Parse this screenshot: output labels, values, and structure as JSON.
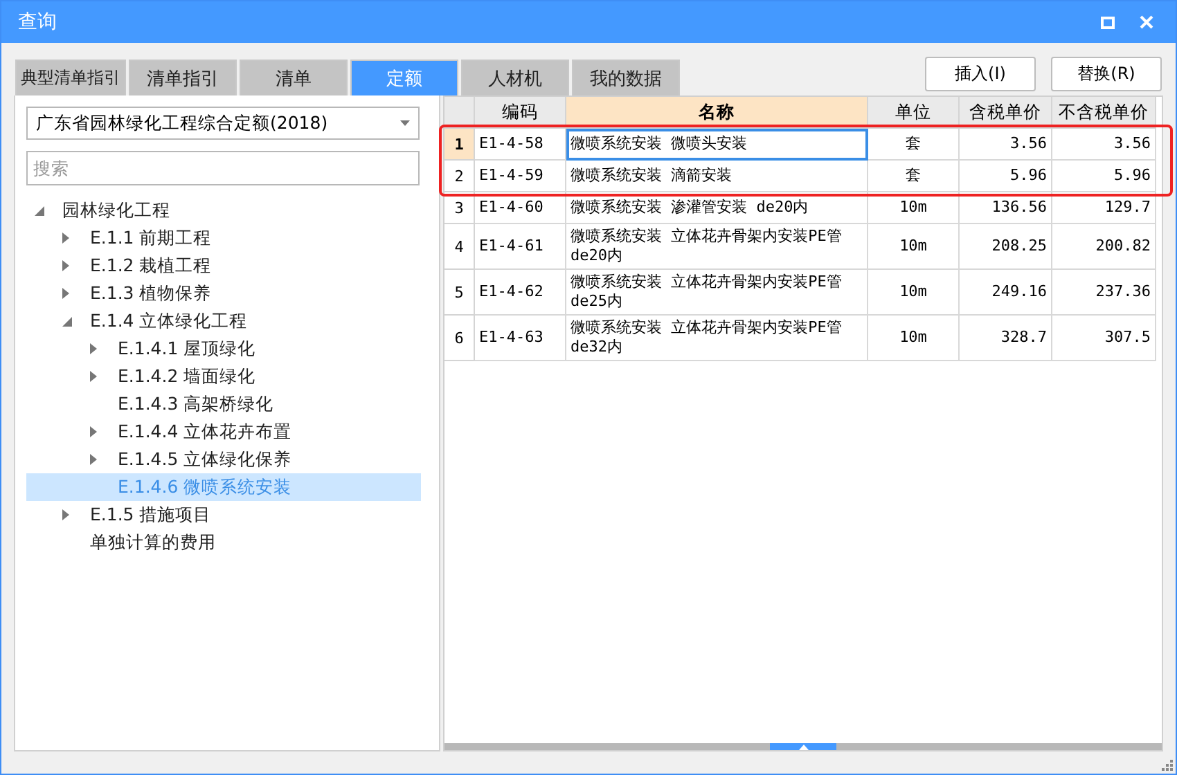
{
  "window": {
    "title": "查询"
  },
  "tabs": [
    {
      "label": "典型清单指引",
      "selected": false
    },
    {
      "label": "清单指引",
      "selected": false
    },
    {
      "label": "清单",
      "selected": false
    },
    {
      "label": "定额",
      "selected": true
    },
    {
      "label": "人材机",
      "selected": false
    },
    {
      "label": "我的数据",
      "selected": false
    }
  ],
  "buttons": [
    "插入(I)",
    "替换(R)"
  ],
  "library_select": {
    "value": "广东省园林绿化工程综合定额(2018)"
  },
  "search": {
    "placeholder": "搜索"
  },
  "tree": [
    {
      "label": "园林绿化工程",
      "expanded": true,
      "selected": false,
      "children": [
        {
          "label": "E.1.1 前期工程",
          "expanded": false,
          "selected": false
        },
        {
          "label": "E.1.2 栽植工程",
          "expanded": false,
          "selected": false
        },
        {
          "label": "E.1.3 植物保养",
          "expanded": false,
          "selected": false
        },
        {
          "label": "E.1.4 立体绿化工程",
          "expanded": true,
          "selected": false,
          "children": [
            {
              "label": "E.1.4.1 屋顶绿化",
              "expanded": false,
              "selected": false
            },
            {
              "label": "E.1.4.2 墙面绿化",
              "expanded": false,
              "selected": false
            },
            {
              "label": "E.1.4.3 高架桥绿化",
              "selected": false
            },
            {
              "label": "E.1.4.4 立体花卉布置",
              "expanded": false,
              "selected": false
            },
            {
              "label": "E.1.4.5 立体绿化保养",
              "expanded": false,
              "selected": false
            },
            {
              "label": "E.1.4.6 微喷系统安装",
              "selected": true
            }
          ]
        },
        {
          "label": "E.1.5 措施项目",
          "expanded": false,
          "selected": false
        },
        {
          "label": "单独计算的费用",
          "selected": false
        }
      ]
    }
  ],
  "table": {
    "columns": [
      "编码",
      "名称",
      "单位",
      "含税单价",
      "不含税单价"
    ],
    "rows": [
      {
        "index": "1",
        "selected": true,
        "highlighted": true,
        "cells": [
          "E1-4-58",
          "微喷系统安装 微喷头安装",
          "套",
          "3.56",
          "3.56"
        ]
      },
      {
        "index": "2",
        "selected": false,
        "highlighted": true,
        "cells": [
          "E1-4-59",
          "微喷系统安装 滴箭安装",
          "套",
          "5.96",
          "5.96"
        ]
      },
      {
        "index": "3",
        "selected": false,
        "highlighted": false,
        "cells": [
          "E1-4-60",
          "微喷系统安装 渗灌管安装 de20内",
          "10m",
          "136.56",
          "129.7"
        ]
      },
      {
        "index": "4",
        "selected": false,
        "highlighted": false,
        "cells": [
          "E1-4-61",
          "微喷系统安装 立体花卉骨架内安装PE管de20内",
          "10m",
          "208.25",
          "200.82"
        ]
      },
      {
        "index": "5",
        "selected": false,
        "highlighted": false,
        "cells": [
          "E1-4-62",
          "微喷系统安装 立体花卉骨架内安装PE管de25内",
          "10m",
          "249.16",
          "237.36"
        ]
      },
      {
        "index": "6",
        "selected": false,
        "highlighted": false,
        "cells": [
          "E1-4-63",
          "微喷系统安装 立体花卉骨架内安装PE管de32内",
          "10m",
          "328.7",
          "307.5"
        ]
      }
    ]
  }
}
